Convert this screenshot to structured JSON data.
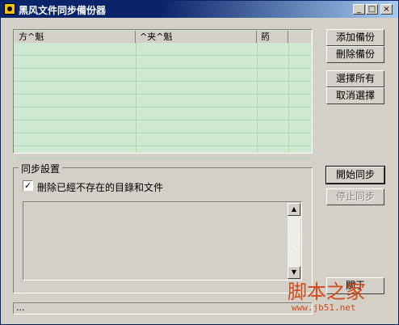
{
  "window": {
    "title": "黑风文件同步備份器",
    "minimize_glyph": "_",
    "maximize_glyph": "□",
    "close_glyph": "×"
  },
  "list": {
    "columns": [
      "方^魁",
      "^夹^魁",
      "箹"
    ],
    "row_count": 9,
    "row_color": "#cfe9d1"
  },
  "buttons": {
    "add_backup": "添加備份",
    "delete_backup": "刪除備份",
    "select_all": "選擇所有",
    "cancel_selection": "取消選擇",
    "start_sync": "開始同步",
    "stop_sync": "停止同步",
    "about": "關于"
  },
  "sync_settings": {
    "group_label": "同步設置",
    "delete_missing_label": "刪除已經不存在的目錄和文件",
    "delete_missing_checked": true,
    "checkmark": "✓"
  },
  "scrollbar": {
    "up": "▲",
    "down": "▼"
  },
  "status_bar": {
    "text": "..."
  },
  "watermark": {
    "line1": "脚本之家",
    "line2": "www.jb51.net"
  }
}
